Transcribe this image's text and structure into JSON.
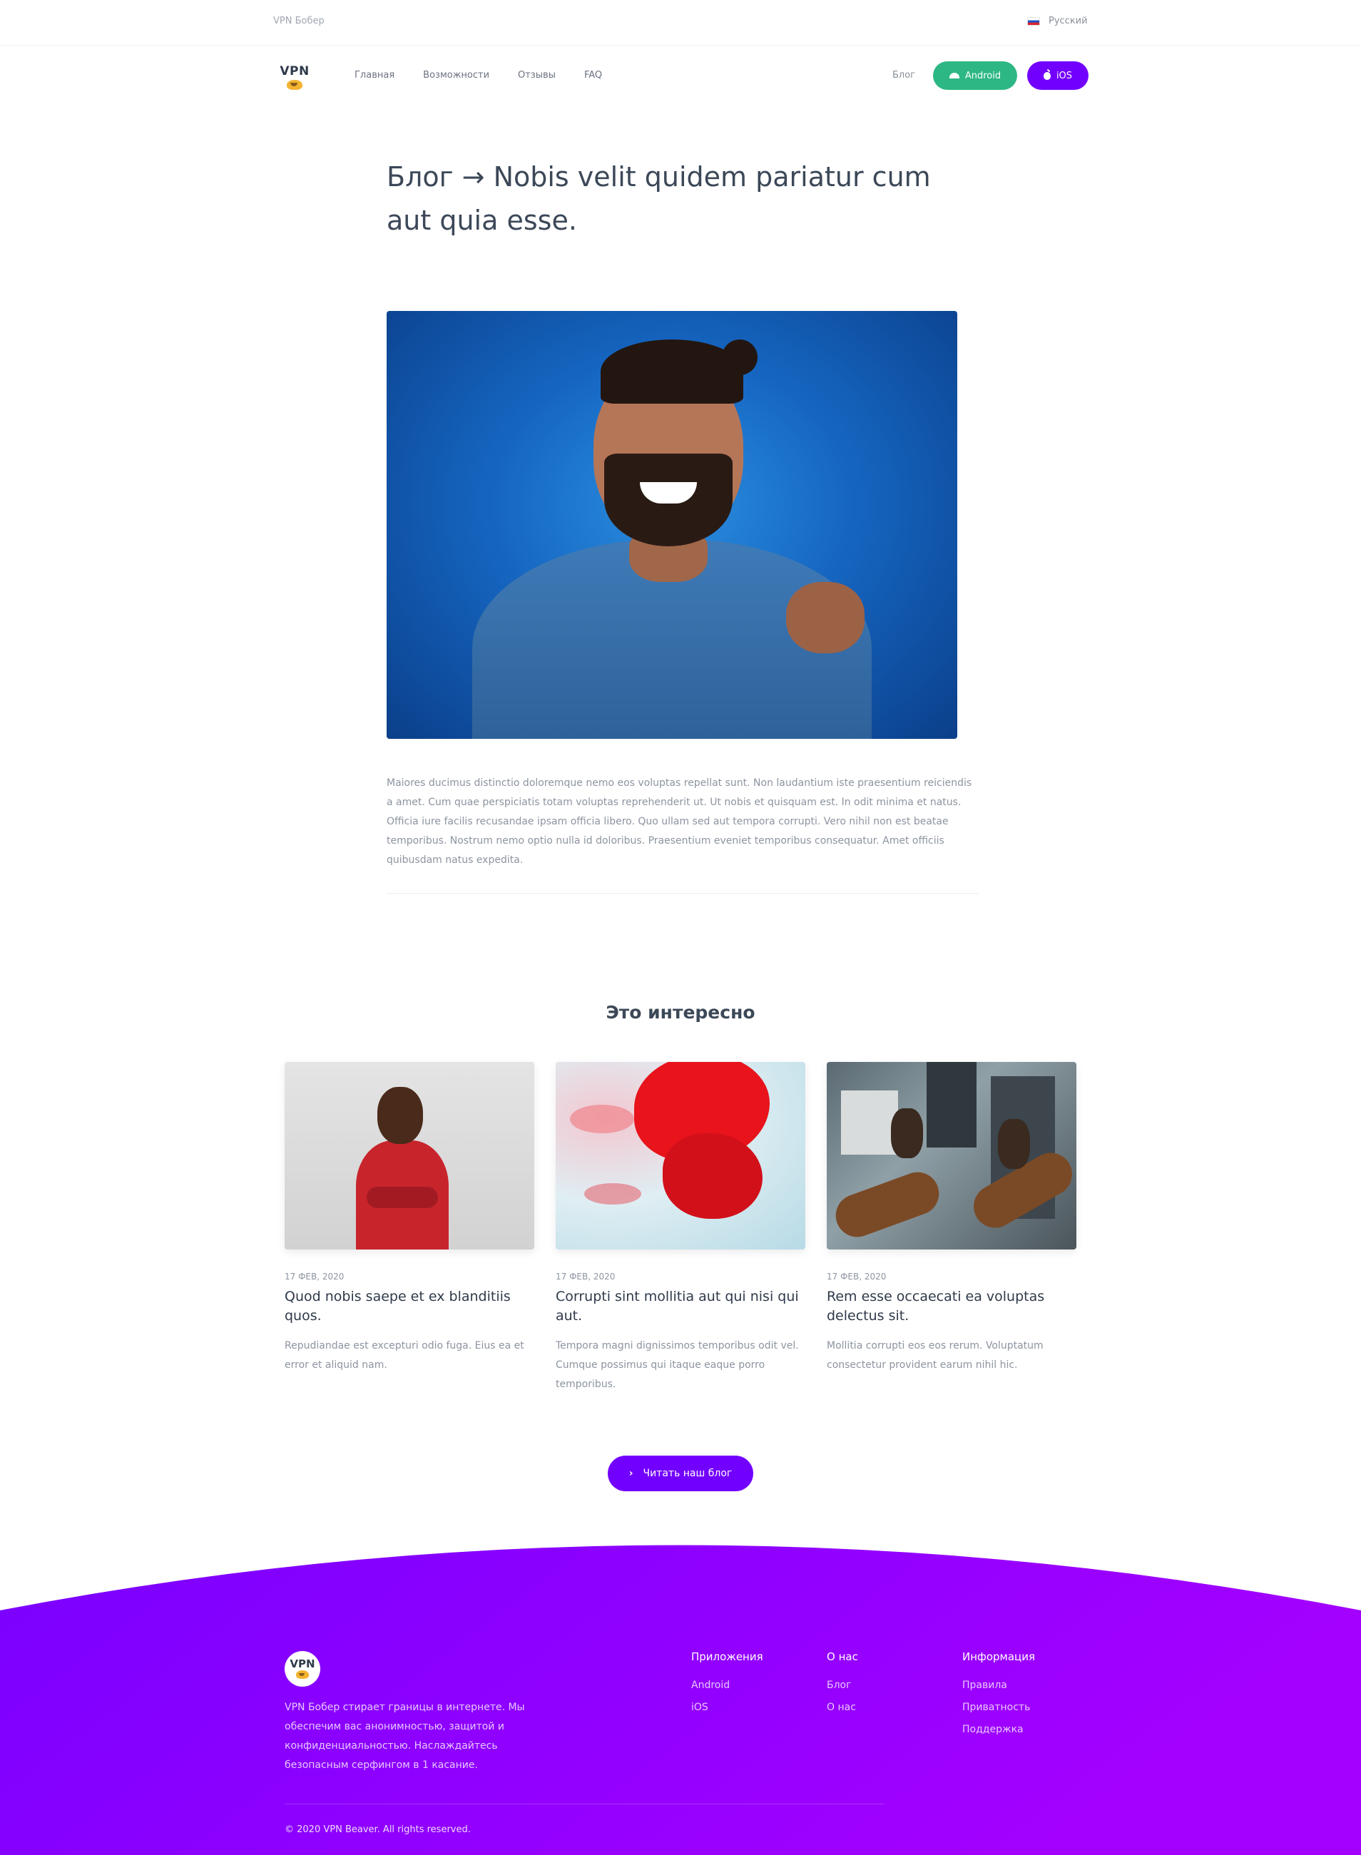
{
  "topbar": {
    "brand": "VPN Бобер",
    "language": "Русский"
  },
  "nav": {
    "logo_text": "VPN",
    "links": [
      "Главная",
      "Возможности",
      "Отзывы",
      "FAQ"
    ],
    "blog": "Блог",
    "android_label": "Android",
    "ios_label": "iOS"
  },
  "article": {
    "title": "Блог → Nobis velit quidem pariatur cum aut quia esse.",
    "body": "Maiores ducimus distinctio doloremque nemo eos voluptas repellat sunt. Non laudantium iste praesentium reiciendis a amet. Cum quae perspiciatis totam voluptas reprehenderit ut. Ut nobis et quisquam est. In odit minima et natus. Officia iure facilis recusandae ipsam officia libero. Quo ullam sed aut tempora corrupti. Vero nihil non est beatae temporibus. Nostrum nemo optio nulla id doloribus. Praesentium eveniet temporibus consequatur. Amet officiis quibusdam natus expedita."
  },
  "related": {
    "title": "Это интересно",
    "cards": [
      {
        "date": "17 ФЕВ, 2020",
        "title": "Quod nobis saepe et ex blanditiis quos.",
        "desc": "Repudiandae est excepturi odio fuga. Eius ea et error et aliquid nam."
      },
      {
        "date": "17 ФЕВ, 2020",
        "title": "Corrupti sint mollitia aut qui nisi qui aut.",
        "desc": "Tempora magni dignissimos temporibus odit vel. Cumque possimus qui itaque eaque porro temporibus."
      },
      {
        "date": "17 ФЕВ, 2020",
        "title": "Rem esse occaecati ea voluptas delectus sit.",
        "desc": "Mollitia corrupti eos eos rerum. Voluptatum consectetur provident earum nihil hic."
      }
    ],
    "button_label": "Читать наш блог"
  },
  "footer": {
    "logo_text": "VPN",
    "about": "VPN Бобер стирает границы в интернете. Мы обеспечим вас анонимностью, защитой и конфиденциальностью. Наслаждайтесь безопасным серфингом в 1 касание.",
    "columns": [
      {
        "title": "Приложения",
        "items": [
          "Android",
          "iOS"
        ]
      },
      {
        "title": "О нас",
        "items": [
          "Блог",
          "О нас"
        ]
      },
      {
        "title": "Информация",
        "items": [
          "Правила",
          "Приватность",
          "Поддержка"
        ]
      }
    ],
    "copyright": "© 2020 VPN Beaver. All rights reserved."
  },
  "colors": {
    "accent": "#7200ff",
    "android": "#2db784",
    "footer_gradient_start": "#7a00ff",
    "footer_gradient_end": "#a400ff"
  },
  "icons": {
    "flag": "russia-flag-icon",
    "android": "android-icon",
    "ios": "apple-icon",
    "button": "chevron-right-icon"
  }
}
